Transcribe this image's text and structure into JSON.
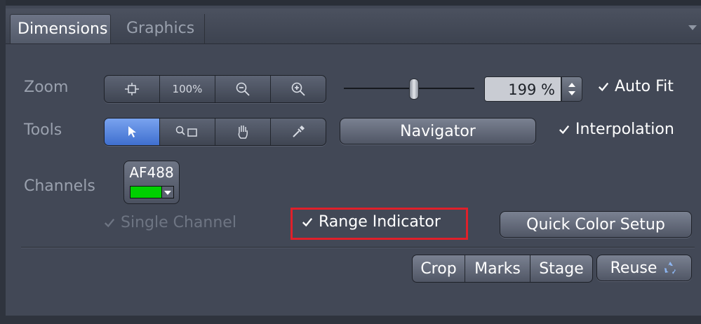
{
  "tabs": [
    {
      "label": "Dimensions",
      "active": true
    },
    {
      "label": "Graphics",
      "active": false
    }
  ],
  "zoom": {
    "label": "Zoom",
    "buttons": [
      {
        "icon": "fit-to-window-icon"
      },
      {
        "text": "100%"
      },
      {
        "icon": "zoom-out-icon"
      },
      {
        "icon": "zoom-in-icon"
      }
    ],
    "slider_fraction": 0.54,
    "value": "199 %",
    "auto_fit_label": "Auto Fit",
    "auto_fit_checked": true
  },
  "tools": {
    "label": "Tools",
    "buttons": [
      {
        "icon": "pointer-icon",
        "active": true
      },
      {
        "icon": "zoom-rectangle-icon",
        "active": false
      },
      {
        "icon": "hand-pan-icon",
        "active": false
      },
      {
        "icon": "eyedropper-icon",
        "active": false
      }
    ],
    "navigator_label": "Navigator",
    "interpolation_label": "Interpolation",
    "interpolation_checked": true
  },
  "channels": {
    "label": "Channels",
    "channel_name": "AF488",
    "channel_color": "#00d000",
    "single_channel_label": "Single Channel",
    "single_channel_checked": true,
    "range_indicator_label": "Range Indicator",
    "range_indicator_checked": true,
    "quick_color_setup_label": "Quick Color Setup"
  },
  "bottom_buttons": {
    "crop": "Crop",
    "marks": "Marks",
    "stage": "Stage",
    "reuse": "Reuse"
  },
  "colors": {
    "panel_background": "#424856",
    "active_blue": "#3f6fcf",
    "highlight_red": "#e0202a"
  }
}
